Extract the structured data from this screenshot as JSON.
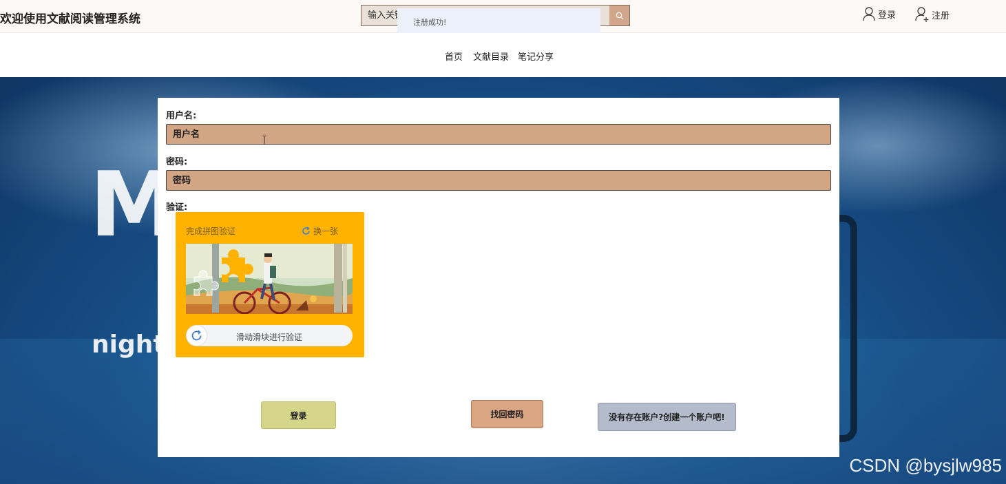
{
  "header": {
    "site_title": "欢迎使用文献阅读管理系统",
    "search_placeholder": "输入关键字",
    "search_icon": "search-icon",
    "toast_message": "注册成功!",
    "login_label": "登录",
    "register_label": "注册"
  },
  "nav": {
    "items": [
      {
        "label": "首页"
      },
      {
        "label": "文献目录"
      },
      {
        "label": "笔记分享"
      }
    ]
  },
  "hero": {
    "big_letter": "M",
    "tagline": "night"
  },
  "form": {
    "username_label": "用户名:",
    "username_placeholder": "用户名",
    "password_label": "密码:",
    "password_placeholder": "密码",
    "verify_label": "验证:"
  },
  "captcha": {
    "title": "完成拼图验证",
    "refresh_label": "换一张",
    "slider_text": "滑动滑块进行验证",
    "bg_color": "#ffb300"
  },
  "buttons": {
    "login": "登录",
    "find_password": "找回密码",
    "create_account": "没有存在账户?创建一个账户吧!"
  },
  "watermark": "CSDN @bysjlw985",
  "colors": {
    "input_bg": "#d2a685",
    "login_btn": "#d6d68a",
    "find_btn": "#d9a582",
    "create_btn": "#b4bccb",
    "search_btn": "#d2a68a"
  }
}
